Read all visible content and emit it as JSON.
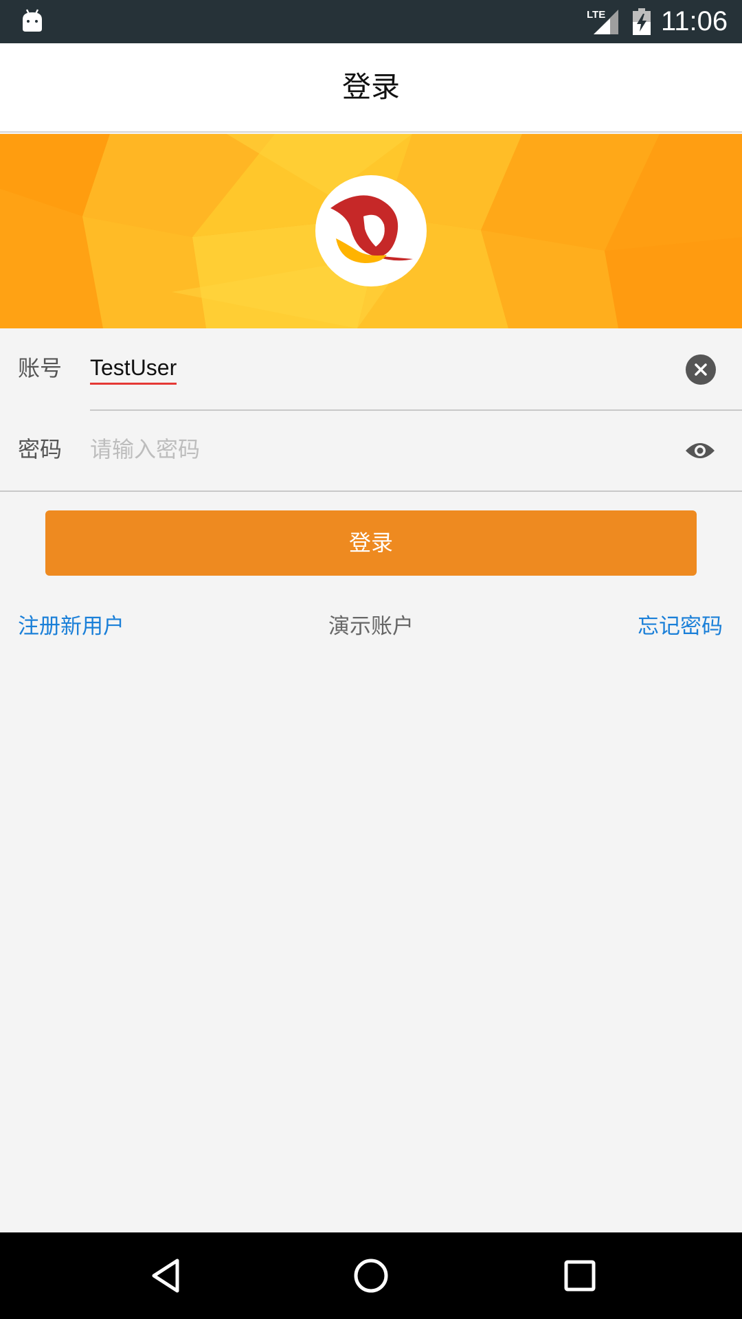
{
  "status_bar": {
    "time": "11:06",
    "network_label": "LTE",
    "icons": [
      "android-icon",
      "lte-signal-icon",
      "battery-charging-icon"
    ]
  },
  "header": {
    "title": "登录"
  },
  "banner": {
    "logo": "brand-logo",
    "colors": {
      "primary": "#ffb300",
      "secondary": "#ff9800",
      "logo_red": "#c62828",
      "logo_yellow": "#ffb300"
    }
  },
  "form": {
    "account_label": "账号",
    "account_value": "TestUser",
    "password_label": "密码",
    "password_placeholder": "请输入密码",
    "clear_icon": "close-circle-icon",
    "visibility_icon": "eye-icon"
  },
  "actions": {
    "login_label": "登录",
    "login_color": "#ee8a20"
  },
  "links": {
    "register": "注册新用户",
    "demo": "演示账户",
    "forgot": "忘记密码",
    "link_color": "#1a7fd8"
  },
  "nav_bar": {
    "icons": [
      "back-icon",
      "home-icon",
      "recents-icon"
    ]
  }
}
